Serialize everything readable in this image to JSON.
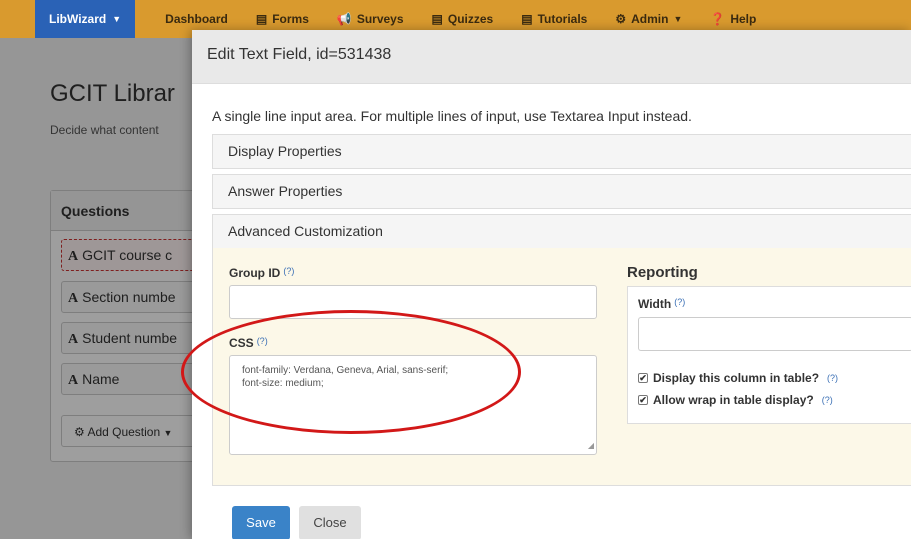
{
  "navbar": {
    "brand": "LibWizard",
    "items": [
      {
        "label": "Dashboard",
        "icon": ""
      },
      {
        "label": "Forms",
        "icon": "list-icon"
      },
      {
        "label": "Surveys",
        "icon": "megaphone-icon"
      },
      {
        "label": "Quizzes",
        "icon": "list-icon"
      },
      {
        "label": "Tutorials",
        "icon": "list-icon"
      },
      {
        "label": "Admin",
        "icon": "gear-icon"
      },
      {
        "label": "Help",
        "icon": "question-icon"
      }
    ]
  },
  "background": {
    "title": "GCIT Librar",
    "description": "Decide what content",
    "questions_header": "Questions",
    "questions": [
      "GCIT course c",
      "Section numbe",
      "Student numbe",
      "Name"
    ],
    "add_question": "Add Question"
  },
  "modal": {
    "title": "Edit Text Field, id=531438",
    "description": "A single line input area. For multiple lines of input, use Textarea Input instead.",
    "sections": [
      "Display Properties",
      "Answer Properties",
      "Advanced Customization"
    ],
    "group_id_label": "Group ID",
    "group_id_value": "",
    "css_label": "CSS",
    "css_line1": "font-family: Verdana, Geneva, Arial, sans-serif;",
    "css_line2": "font-size: medium;",
    "help": "(?)",
    "reporting_title": "Reporting",
    "width_label": "Width",
    "width_value": "",
    "display_column": "Display this column in table?",
    "allow_wrap": "Allow wrap in table display?",
    "save": "Save",
    "close": "Close"
  },
  "colors": {
    "navbar": "#d99a2e",
    "brand": "#2a62b6",
    "save_button": "#3a83c8",
    "annotation": "#d21818"
  }
}
